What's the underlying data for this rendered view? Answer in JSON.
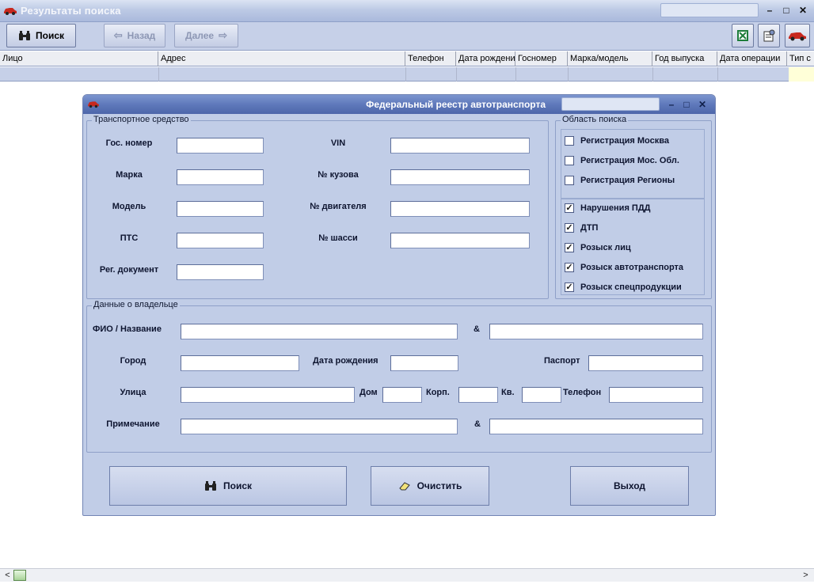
{
  "window": {
    "title": "Результаты поиска",
    "controls": {
      "minimize": "–",
      "maximize": "□",
      "close": "✕"
    }
  },
  "toolbar": {
    "search_label": "Поиск",
    "back_label": "Назад",
    "forward_label": "Далее"
  },
  "grid": {
    "columns": [
      "Лицо",
      "Адрес",
      "Телефон",
      "Дата рождения",
      "Госномер",
      "Марка/модель",
      "Год выпуска",
      "Дата операции",
      "Тип с"
    ]
  },
  "dialog": {
    "title": "Федеральный реестр автотранспорта",
    "controls": {
      "minimize": "–",
      "maximize": "□",
      "close": "✕"
    },
    "vehicle_group": {
      "label": "Транспортное средство",
      "gos_nomer": "Гос. номер",
      "marka": "Марка",
      "model": "Модель",
      "pts": "ПТС",
      "reg_doc": "Рег. документ",
      "vin": "VIN",
      "kuzov": "№ кузова",
      "dvigatel": "№ двигателя",
      "shassi": "№ шасси"
    },
    "search_area": {
      "label": "Область поиска",
      "items": [
        {
          "label": "Регистрация  Москва",
          "checked": false
        },
        {
          "label": "Регистрация Мос. Обл.",
          "checked": false
        },
        {
          "label": "Регистрация Регионы",
          "checked": false
        },
        {
          "label": "Нарушения ПДД",
          "checked": true
        },
        {
          "label": "ДТП",
          "checked": true
        },
        {
          "label": "Розыск лиц",
          "checked": true
        },
        {
          "label": "Розыск автотранспорта",
          "checked": true
        },
        {
          "label": "Розыск спецпродукции",
          "checked": true
        }
      ]
    },
    "owner_group": {
      "label": "Данные о владельце",
      "fio": "ФИО / Название",
      "amp1": "&",
      "gorod": "Город",
      "data_rozhd": "Дата рождения",
      "pasport": "Паспорт",
      "ulica": "Улица",
      "dom": "Дом",
      "korp": "Корп.",
      "kv": "Кв.",
      "telefon": "Телефон",
      "primechanie": "Примечание",
      "amp2": "&"
    },
    "buttons": {
      "search": "Поиск",
      "clear": "Очистить",
      "exit": "Выход"
    }
  },
  "icons": {
    "app": "car-icon",
    "search": "binoculars-icon",
    "excel": "excel-icon",
    "properties": "properties-icon",
    "clear": "eraser-icon"
  },
  "colors": {
    "dialog_bg": "#c1cde7",
    "dialog_title": "#5f79bb",
    "toolbar_bg": "#c6d0e8",
    "selected_cell": "#ffffd8"
  }
}
